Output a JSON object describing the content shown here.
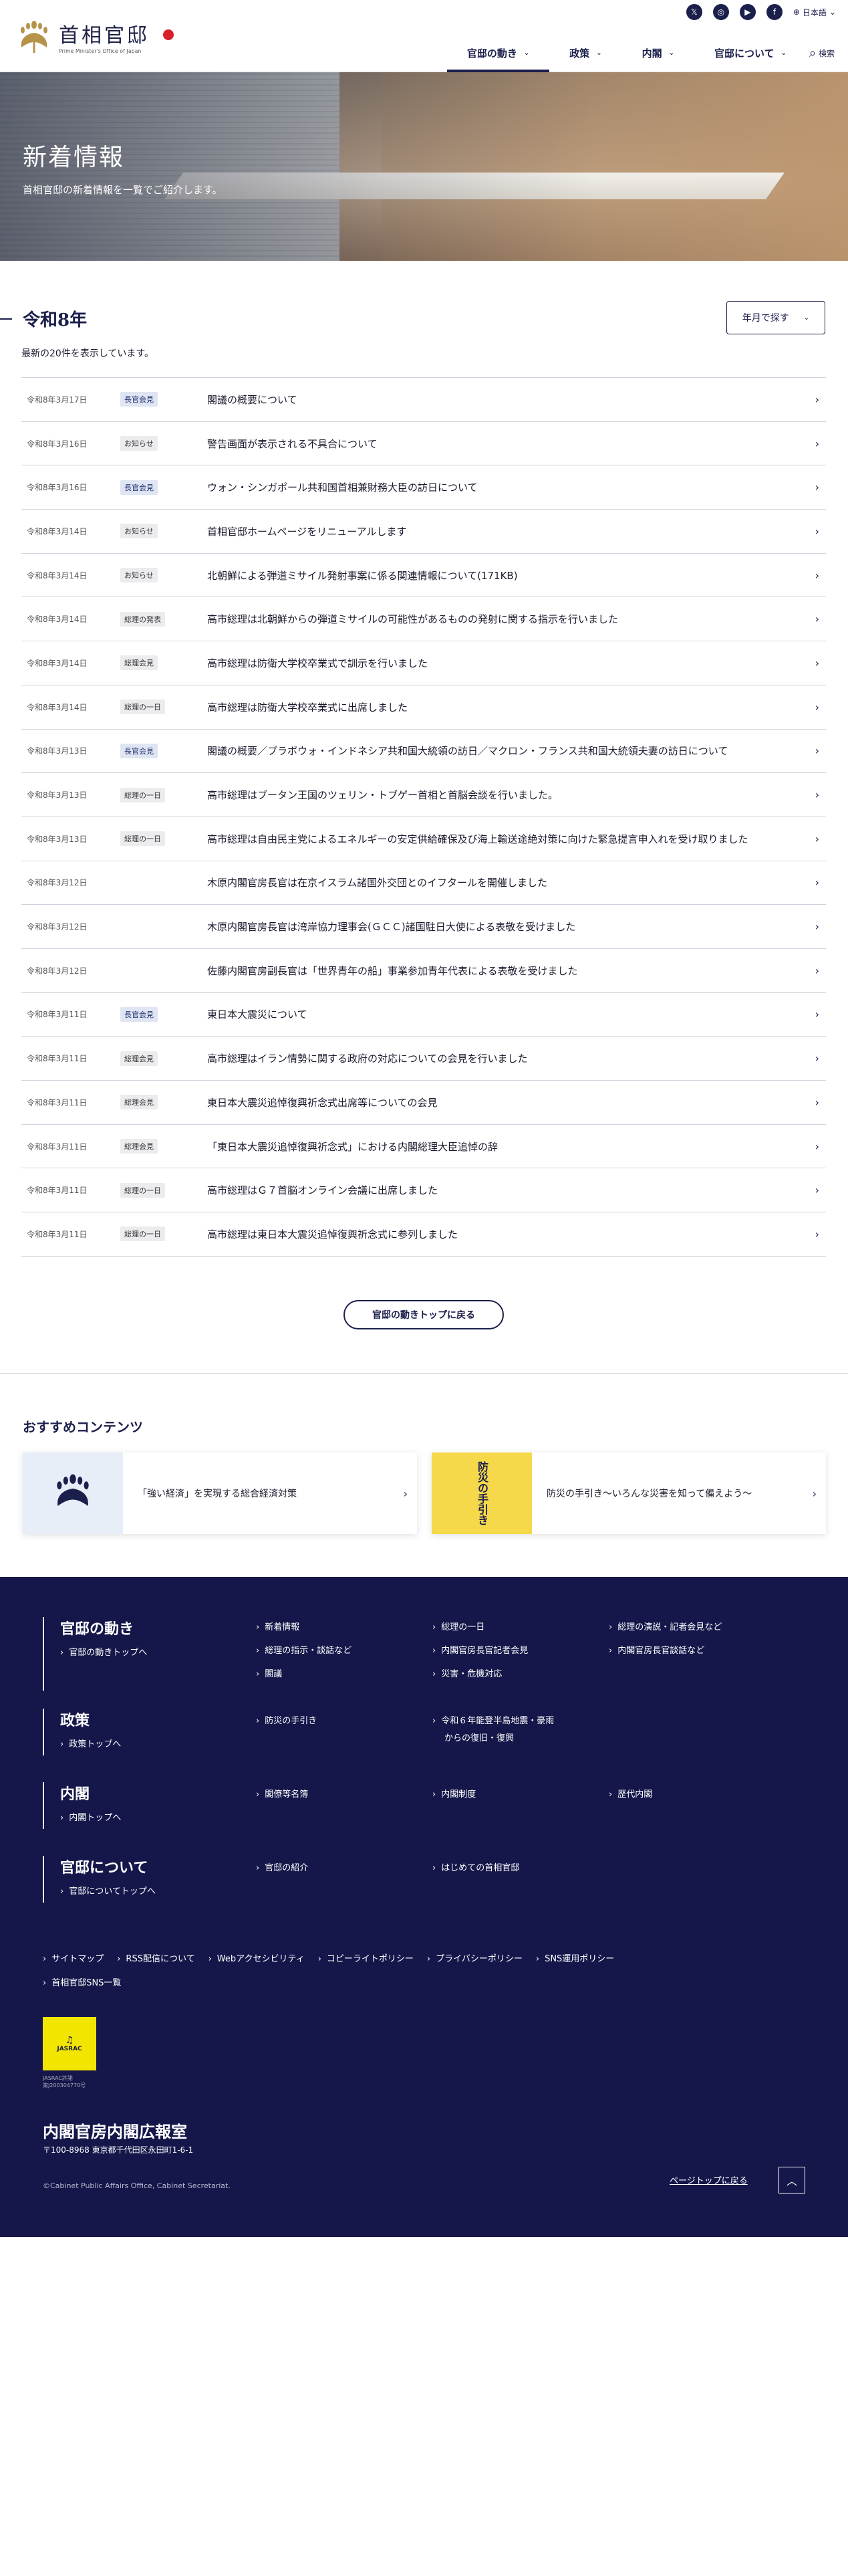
{
  "header": {
    "logo_jp": "首相官邸",
    "logo_en": "Prime Minister's Office of Japan",
    "language": "日本語",
    "nav": [
      {
        "label": "官邸の動き"
      },
      {
        "label": "政策"
      },
      {
        "label": "内閣"
      },
      {
        "label": "官邸について"
      }
    ],
    "search_label": "検索"
  },
  "hero": {
    "title": "新着情報",
    "subtitle": "首相官邸の新着情報を一覧でご紹介します。"
  },
  "main": {
    "year": "令和8年",
    "count_text": "最新の20件を表示しています。",
    "year_select": "年月で探す",
    "items": [
      {
        "date": "令和8年3月17日",
        "badge": "長官会見",
        "kind": "kanbo",
        "title": "閣議の概要について"
      },
      {
        "date": "令和8年3月16日",
        "badge": "お知らせ",
        "kind": "gray",
        "title": "警告画面が表示される不具合について"
      },
      {
        "date": "令和8年3月16日",
        "badge": "長官会見",
        "kind": "kanbo",
        "title": "ウォン・シンガポール共和国首相兼財務大臣の訪日について"
      },
      {
        "date": "令和8年3月14日",
        "badge": "お知らせ",
        "kind": "gray",
        "title": "首相官邸ホームページをリニューアルします"
      },
      {
        "date": "令和8年3月14日",
        "badge": "お知らせ",
        "kind": "gray",
        "title": "北朝鮮による弾道ミサイル発射事案に係る関連情報について(171KB)"
      },
      {
        "date": "令和8年3月14日",
        "badge": "総理の発表",
        "kind": "gray",
        "title": "高市総理は北朝鮮からの弾道ミサイルの可能性があるものの発射に関する指示を行いました"
      },
      {
        "date": "令和8年3月14日",
        "badge": "総理会見",
        "kind": "gray",
        "title": "高市総理は防衛大学校卒業式で訓示を行いました"
      },
      {
        "date": "令和8年3月14日",
        "badge": "総理の一日",
        "kind": "gray",
        "title": "高市総理は防衛大学校卒業式に出席しました"
      },
      {
        "date": "令和8年3月13日",
        "badge": "長官会見",
        "kind": "kanbo",
        "title": "閣議の概要／プラボウォ・インドネシア共和国大統領の訪日／マクロン・フランス共和国大統領夫妻の訪日について"
      },
      {
        "date": "令和8年3月13日",
        "badge": "総理の一日",
        "kind": "gray",
        "title": "高市総理はブータン王国のツェリン・トブゲー首相と首脳会談を行いました。"
      },
      {
        "date": "令和8年3月13日",
        "badge": "総理の一日",
        "kind": "gray",
        "title": "高市総理は自由民主党によるエネルギーの安定供給確保及び海上輸送途絶対策に向けた緊急提言申入れを受け取りました"
      },
      {
        "date": "令和8年3月12日",
        "badge": "",
        "kind": "",
        "title": "木原内閣官房長官は在京イスラム諸国外交団とのイフタールを開催しました"
      },
      {
        "date": "令和8年3月12日",
        "badge": "",
        "kind": "",
        "title": "木原内閣官房長官は湾岸協力理事会(ＧＣＣ)諸国駐日大使による表敬を受けました"
      },
      {
        "date": "令和8年3月12日",
        "badge": "",
        "kind": "",
        "title": "佐藤内閣官房副長官は「世界青年の船」事業参加青年代表による表敬を受けました"
      },
      {
        "date": "令和8年3月11日",
        "badge": "長官会見",
        "kind": "kanbo",
        "title": "東日本大震災について"
      },
      {
        "date": "令和8年3月11日",
        "badge": "総理会見",
        "kind": "gray",
        "title": "高市総理はイラン情勢に関する政府の対応についての会見を行いました"
      },
      {
        "date": "令和8年3月11日",
        "badge": "総理会見",
        "kind": "gray",
        "title": "東日本大震災追悼復興祈念式出席等についての会見"
      },
      {
        "date": "令和8年3月11日",
        "badge": "総理会見",
        "kind": "gray",
        "title": "「東日本大震災追悼復興祈念式」における内閣総理大臣追悼の辞"
      },
      {
        "date": "令和8年3月11日",
        "badge": "総理の一日",
        "kind": "gray",
        "title": "高市総理はＧ７首脳オンライン会議に出席しました"
      },
      {
        "date": "令和8年3月11日",
        "badge": "総理の一日",
        "kind": "gray",
        "title": "高市総理は東日本大震災追悼復興祈念式に参列しました"
      }
    ],
    "back_button": "官邸の動きトップに戻る"
  },
  "recommended": {
    "title": "おすすめコンテンツ",
    "cards": [
      {
        "text": "「強い経済」を実現する総合経済対策"
      },
      {
        "text": "防災の手引き～いろんな災害を知って備えよう～"
      }
    ],
    "bousai_thumb": "防災の手引き"
  },
  "footer": {
    "sections": [
      {
        "title": "官邸の動き",
        "top": "官邸の動きトップへ",
        "links": [
          "新着情報",
          "総理の一日",
          "総理の演説・記者会見など",
          "総理の指示・談話など",
          "内閣官房長官記者会見",
          "内閣官房長官談話など",
          "閣議",
          "災害・危機対応"
        ]
      },
      {
        "title": "政策",
        "top": "政策トップへ",
        "links": [
          "防災の手引き",
          "令和６年能登半島地震・豪雨",
          "からの復旧・復興"
        ]
      },
      {
        "title": "内閣",
        "top": "内閣トップへ",
        "links": [
          "閣僚等名簿",
          "内閣制度",
          "歴代内閣"
        ]
      },
      {
        "title": "官邸について",
        "top": "官邸についてトップへ",
        "links": [
          "官邸の紹介",
          "はじめての首相官邸"
        ]
      }
    ],
    "util": [
      "サイトマップ",
      "RSS配信について",
      "Webアクセシビリティ",
      "コピーライトポリシー",
      "プライバシーポリシー",
      "SNS運用ポリシー"
    ],
    "sns": "首相官邸SNS一覧",
    "jasrac_line1": "JASRAC許諾",
    "jasrac_line2": "第J200304770号",
    "org": "内閣官房内閣広報室",
    "address": "〒100-8968 東京都千代田区永田町1-6-1",
    "copyright": "©Cabinet Public Affairs Office, Cabinet Secretariat.",
    "pagetop": "ページトップに戻る"
  }
}
